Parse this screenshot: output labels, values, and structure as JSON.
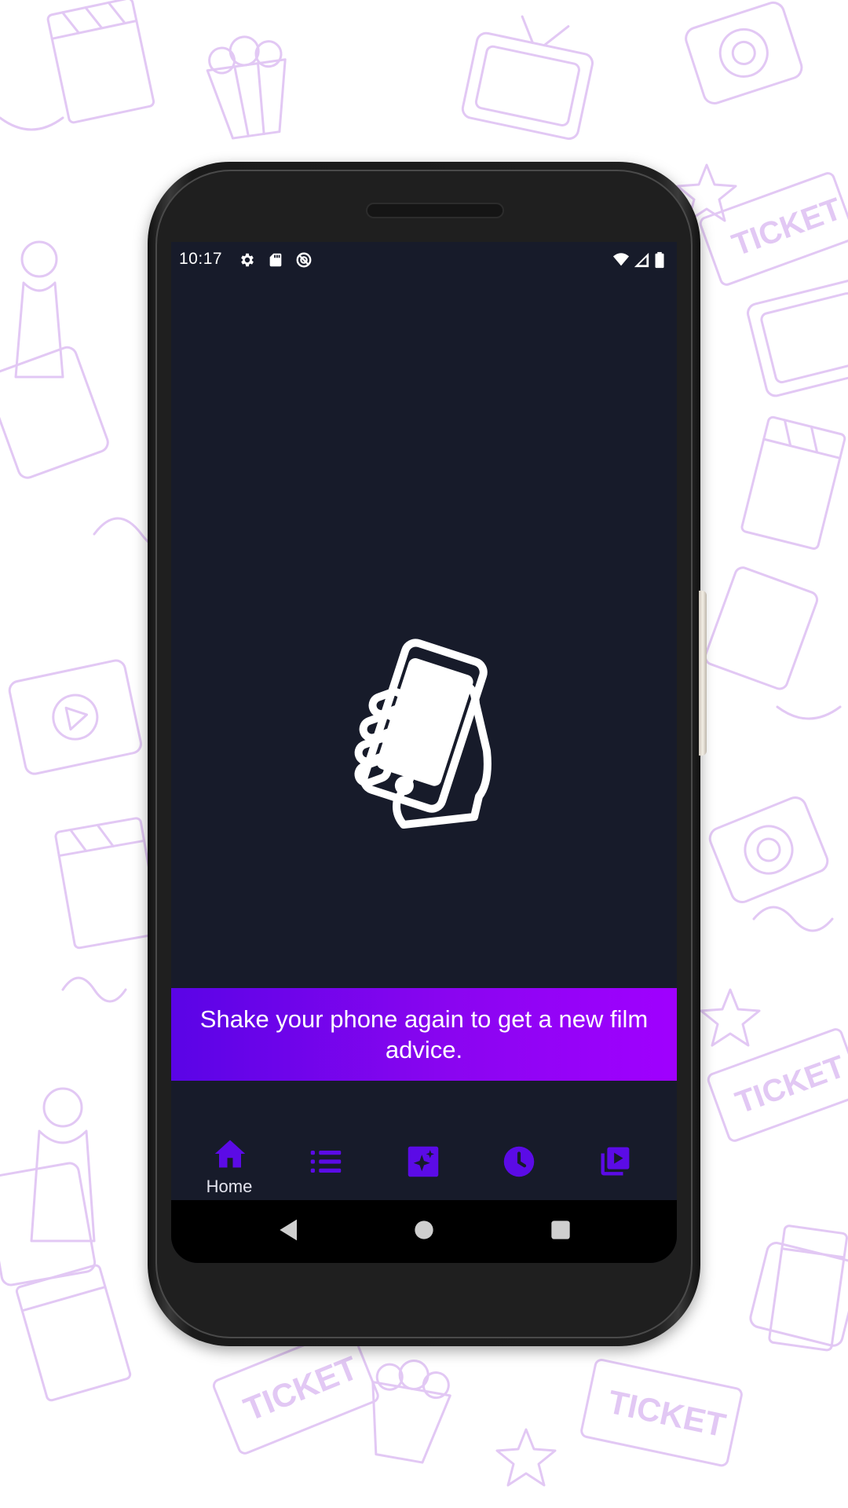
{
  "status_bar": {
    "time": "10:17",
    "left_icons": [
      "settings-icon",
      "sd-card-icon",
      "sync-disabled-icon"
    ],
    "right_icons": [
      "wifi-icon",
      "cell-signal-icon",
      "battery-icon"
    ]
  },
  "main": {
    "illustration": "shake-phone-hand-icon",
    "message": "Shake your phone again to get a new film advice."
  },
  "bottom_nav": {
    "items": [
      {
        "icon": "home-icon",
        "label": "Home",
        "active": true
      },
      {
        "icon": "list-icon",
        "label": "",
        "active": false
      },
      {
        "icon": "sparkle-icon",
        "label": "",
        "active": false
      },
      {
        "icon": "clock-icon",
        "label": "",
        "active": false
      },
      {
        "icon": "video-library-icon",
        "label": "",
        "active": false
      }
    ]
  },
  "system_nav": [
    "back-icon",
    "home-circle-icon",
    "recents-icon"
  ],
  "colors": {
    "screen_background": "#171b2a",
    "accent": "#5b0be6",
    "banner_gradient_start": "#5a04e6",
    "banner_gradient_end": "#a000ff",
    "doodle_color": "#e2c8f4"
  }
}
